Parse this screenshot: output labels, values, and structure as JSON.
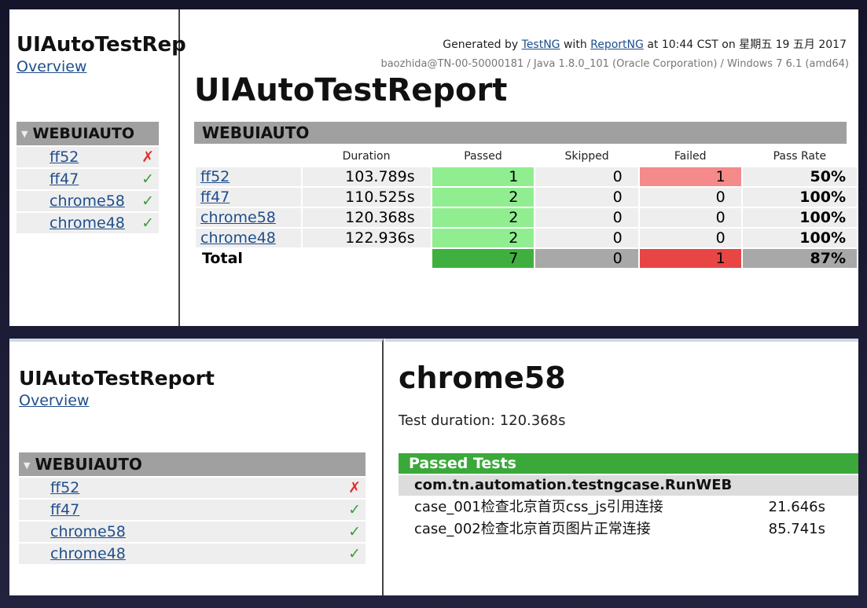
{
  "top": {
    "nav": {
      "title": "UIAutoTestRep",
      "overview": "Overview",
      "suite": "WEBUIAUTO",
      "items": [
        {
          "label": "ff52",
          "mark": "✗",
          "status": "fail"
        },
        {
          "label": "ff47",
          "mark": "✓",
          "status": "pass"
        },
        {
          "label": "chrome58",
          "mark": "✓",
          "status": "pass"
        },
        {
          "label": "chrome48",
          "mark": "✓",
          "status": "pass"
        }
      ]
    },
    "header": {
      "generated_by": "Generated by",
      "testng_link": "TestNG",
      "with": "with",
      "reportng_link": "ReportNG",
      "time_text": "at 10:44 CST on 星期五 19 五月 2017",
      "system_info": "baozhida@TN-00-50000181 / Java 1.8.0_101 (Oracle Corporation) / Windows 7 6.1 (amd64)"
    },
    "report_title": "UIAutoTestReport",
    "suite": "WEBUIAUTO",
    "columns": [
      "",
      "Duration",
      "Passed",
      "Skipped",
      "Failed",
      "Pass Rate"
    ],
    "rows": [
      {
        "test": "ff52",
        "duration": "103.789s",
        "passed": "1",
        "skipped": "0",
        "failed": "1",
        "pass_rate": "50%"
      },
      {
        "test": "ff47",
        "duration": "110.525s",
        "passed": "2",
        "skipped": "0",
        "failed": "0",
        "pass_rate": "100%"
      },
      {
        "test": "chrome58",
        "duration": "120.368s",
        "passed": "2",
        "skipped": "0",
        "failed": "0",
        "pass_rate": "100%"
      },
      {
        "test": "chrome48",
        "duration": "122.936s",
        "passed": "2",
        "skipped": "0",
        "failed": "0",
        "pass_rate": "100%"
      }
    ],
    "total": {
      "label": "Total",
      "passed": "7",
      "skipped": "0",
      "failed": "1",
      "pass_rate": "87%"
    }
  },
  "bottom": {
    "nav": {
      "title": "UIAutoTestReport",
      "overview": "Overview",
      "suite": "WEBUIAUTO",
      "items": [
        {
          "label": "ff52",
          "mark": "✗",
          "status": "fail"
        },
        {
          "label": "ff47",
          "mark": "✓",
          "status": "pass"
        },
        {
          "label": "chrome58",
          "mark": "✓",
          "status": "pass"
        },
        {
          "label": "chrome48",
          "mark": "✓",
          "status": "pass"
        }
      ]
    },
    "test_title": "chrome58",
    "duration_text": "Test duration: 120.368s",
    "passed_header": "Passed Tests",
    "class_name": "com.tn.automation.testngcase.RunWEB",
    "cases": [
      {
        "name": "case_001检查北京首页css_js引用连接",
        "duration": "21.646s"
      },
      {
        "name": "case_002检查北京首页图片正常连接",
        "duration": "85.741s"
      }
    ]
  },
  "colors": {
    "passed_cell": "#90ee90",
    "failed_cell": "#f48a8a",
    "total_passed": "#3fb03f",
    "total_failed": "#e84545",
    "passed_tests_header": "#3aa93a",
    "suite_header": "#a0a0a0"
  }
}
